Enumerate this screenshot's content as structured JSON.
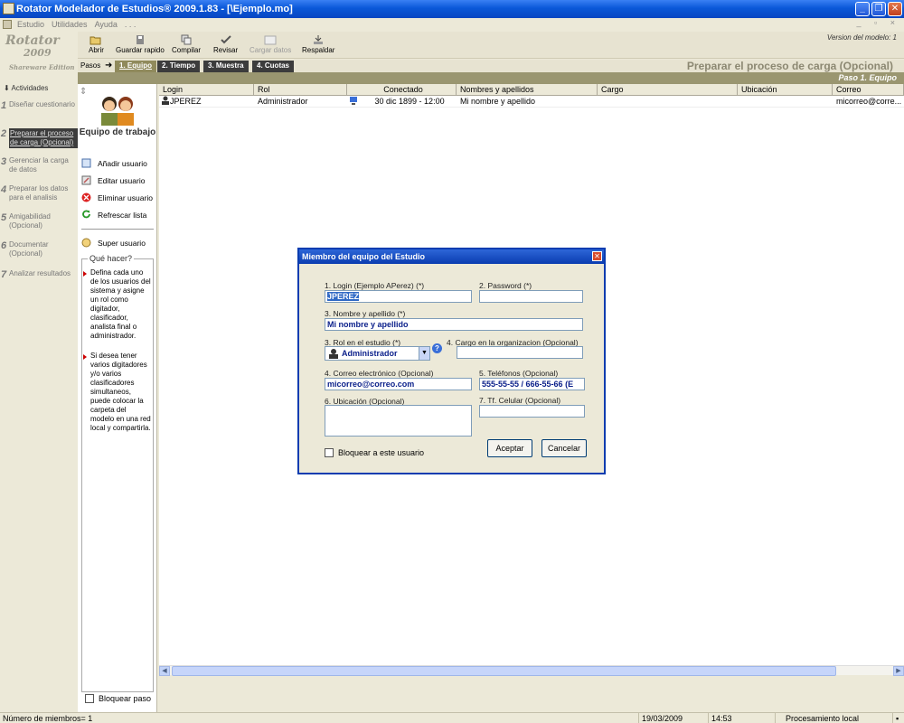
{
  "window": {
    "title": "Rotator Modelador de Estudios® 2009.1.83 - [\\Ejemplo.mo]",
    "controls": [
      "_",
      "❐",
      "✕"
    ]
  },
  "menu": {
    "items": [
      "Estudio",
      "Utilidades",
      "Ayuda"
    ],
    "dots": ". . ."
  },
  "logo": {
    "line1": "Rotator",
    "line2": "2009",
    "line3": "Shareware Edition"
  },
  "toolbar": {
    "buttons": [
      {
        "label": "Abrir",
        "icon": "folder-open-icon"
      },
      {
        "label": "Guardar rapido",
        "icon": "save-icon"
      },
      {
        "label": "Compilar",
        "icon": "compile-icon"
      },
      {
        "label": "Revisar",
        "icon": "check-icon"
      },
      {
        "label": "Cargar datos",
        "icon": "load-data-icon"
      },
      {
        "label": "Respaldar",
        "icon": "backup-icon"
      }
    ],
    "version_label": "Version del modelo: 1"
  },
  "steps": {
    "pasos_label": "Pasos",
    "tabs": [
      "1. Equipo",
      "2. Tiempo",
      "3. Muestra",
      "4. Cuotas"
    ],
    "active_index": 0,
    "title": "Preparar el proceso de carga (Opcional)",
    "paso_label": "Paso 1. Equipo"
  },
  "nav": {
    "header": "Actividades",
    "items": [
      {
        "num": "1",
        "label": "Diseñar cuestionario"
      },
      {
        "num": "2",
        "label": "Preparar el proceso de carga (Opcional)",
        "active": true
      },
      {
        "num": "3",
        "label": "Gerenciar la carga de datos"
      },
      {
        "num": "4",
        "label": "Preparar los datos para el analisis"
      },
      {
        "num": "5",
        "label": "Amigabilidad (Opcional)"
      },
      {
        "num": "6",
        "label": "Documentar (Opcional)"
      },
      {
        "num": "7",
        "label": "Analizar resultados"
      }
    ]
  },
  "taskpanel": {
    "title": "Equipo de trabajo",
    "actions": [
      {
        "label": "Añadir usuario",
        "icon": "add-user-icon"
      },
      {
        "label": "Editar usuario",
        "icon": "edit-user-icon"
      },
      {
        "label": "Eliminar usuario",
        "icon": "delete-user-icon"
      },
      {
        "label": "Refrescar lista",
        "icon": "refresh-icon"
      }
    ],
    "super_user": "Super usuario",
    "quehacer_title": "Qué hacer?",
    "help_1": "Defina cada uno de los usuarios del sistema y asigne un rol como digitador, clasificador, analista final o administrador.",
    "help_2": "Si desea tener varios digitadores y/o varios clasificadores simultaneos, puede colocar la carpeta del modelo en una red local y compartirla.",
    "lock_step": "Bloquear paso"
  },
  "grid": {
    "columns": [
      "Login",
      "Rol",
      "Conectado",
      "Nombres y apellidos",
      "Cargo",
      "Ubicación",
      "Correo"
    ],
    "rows": [
      {
        "login": "JPEREZ",
        "rol": "Administrador",
        "conectado": "30 dic 1899 - 12:00",
        "nombre": "Mi nombre y apellido",
        "cargo": "",
        "ubicacion": "",
        "correo": "micorreo@corre..."
      }
    ]
  },
  "statusbar": {
    "members": "Número de miembros= 1",
    "date": "19/03/2009",
    "time": "14:53",
    "mode": "Procesamiento local"
  },
  "dialog": {
    "title": "Miembro del equipo del Estudio",
    "login_label": "1. Login (Ejemplo APerez) (*)",
    "login_value": "JPEREZ",
    "password_label": "2. Password (*)",
    "password_value": "",
    "name_label": "3. Nombre y apellido (*)",
    "name_value": "Mi nombre y apellido",
    "role_label": "3. Rol en el estudio (*)",
    "role_value": "Administrador",
    "cargo_label": "4. Cargo en la organizacion (Opcional)",
    "cargo_value": "",
    "email_label": "4. Correo electrónico (Opcional)",
    "email_value": "micorreo@correo.com",
    "phone_label": "5. Teléfonos (Opcional)",
    "phone_value": "555-55-55 / 666-55-66 (E",
    "location_label": "6. Ubicación (Opcional)",
    "mobile_label": "7. Tf. Celular (Opcional)",
    "mobile_value": "",
    "lock_user": "Bloquear a este usuario",
    "accept": "Aceptar",
    "cancel": "Cancelar"
  }
}
